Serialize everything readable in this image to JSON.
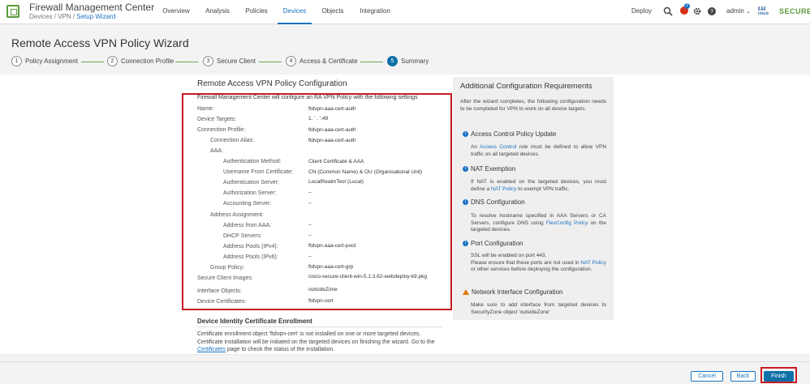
{
  "app": {
    "title": "Firewall Management Center",
    "breadcrumb_prefix": "Devices / VPN / ",
    "breadcrumb_link": "Setup Wizard"
  },
  "nav": [
    "Overview",
    "Analysis",
    "Policies",
    "Devices",
    "Objects",
    "Integration"
  ],
  "nav_active": "Devices",
  "topright": {
    "deploy": "Deploy",
    "alert_count": "2",
    "user": "admin",
    "brand_small": "cisco",
    "brand": "SECURE"
  },
  "wizard": {
    "title": "Remote Access VPN Policy Wizard",
    "steps": [
      {
        "num": "1",
        "label": "Policy Assignment"
      },
      {
        "num": "2",
        "label": "Connection Profile"
      },
      {
        "num": "3",
        "label": "Secure Client"
      },
      {
        "num": "4",
        "label": "Access & Certificate"
      },
      {
        "num": "5",
        "label": "Summary"
      }
    ]
  },
  "config": {
    "title": "Remote Access VPN Policy Configuration",
    "intro": "Firewall Management Center will configure an RA VPN Policy with the following settings",
    "rows": [
      {
        "label": "Name:",
        "value": "ftdvpn-aaa-cert-auth"
      },
      {
        "label": "Device Targets:",
        "value": "1. ' . '.49"
      },
      {
        "label": "Connection Profile:",
        "value": "ftdvpn-aaa-cert-auth"
      },
      {
        "label": "Connection Alias:",
        "value": "ftdvpn-aaa-cert-auth"
      },
      {
        "label": "AAA:",
        "value": ""
      },
      {
        "label": "Authentication Method:",
        "value": "Client Certificate & AAA"
      },
      {
        "label": "Username From Certificate:",
        "value": "CN (Common Name) & OU (Organisational Unit)"
      },
      {
        "label": "Authentication Server:",
        "value": "LocalRealmTest (Local)"
      },
      {
        "label": "Authorization Server:",
        "value": "–"
      },
      {
        "label": "Accounting Server:",
        "value": "–"
      },
      {
        "label": "Address Assignment:",
        "value": ""
      },
      {
        "label": "Address from AAA:",
        "value": "–"
      },
      {
        "label": "DHCP Servers:",
        "value": "–"
      },
      {
        "label": "Address Pools (IPv4):",
        "value": "ftdvpn-aaa-cert-pool"
      },
      {
        "label": "Address Pools (IPv6):",
        "value": "–"
      },
      {
        "label": "Group Policy:",
        "value": "ftdvpn-aaa-cert-grp"
      },
      {
        "label": "Secure Client Images:",
        "value": "cisco-secure-client-win-5.1.3.62-webdeploy-k9.pkg"
      },
      {
        "label": "Interface Objects:",
        "value": "outsideZone"
      },
      {
        "label": "Device Certificates:",
        "value": "ftdvpn-cert"
      }
    ],
    "enroll_title": "Device Identity Certificate Enrollment",
    "enroll_text_1": "Certificate enrollment object 'ftdvpn-cert' is not installed on one or more targeted devices. Certificate installation will be initiated on the targeted devices on finishing the wizard. Go to the ",
    "enroll_link": "Certificates",
    "enroll_text_2": " page to check the status of the installation."
  },
  "additional": {
    "title": "Additional Configuration Requirements",
    "intro": "After the wizard completes, the following configuration needs to be completed for VPN to work on all device targets.",
    "acp_title": "Access Control Policy Update",
    "acp_pre": "An ",
    "acp_link": "Access Control",
    "acp_post": " rule must be defined to allow VPN traffic on all targeted devices.",
    "nat_title": "NAT Exemption",
    "nat_pre": "If NAT is enabled on the targeted devices, you must define a ",
    "nat_link": "NAT Policy",
    "nat_post": " to exempt VPN traffic.",
    "dns_title": "DNS Configuration",
    "dns_pre": "To resolve hostname specified in AAA Servers or CA Servers, configure DNS using ",
    "dns_link": "FlexConfig Policy",
    "dns_post": " on the targeted devices.",
    "port_title": "Port Configuration",
    "port_line": "SSL will be enabled on port 443.",
    "port_pre": "Please ensure that these ports are not used in ",
    "port_link": "NAT Policy",
    "port_post": " or other services before deploying the configuration.",
    "nic_title": "Network Interface Configuration",
    "nic_text": "Make sure to add interface from targeted devices to SecurityZone object 'outsideZone'"
  },
  "footer": {
    "cancel": "Cancel",
    "back": "Back",
    "finish": "Finish"
  },
  "colors": {
    "accent": "#1a73c4",
    "primary_button": "#0e70a8",
    "highlight_border": "#c61b24",
    "brand_green": "#5a9a3a"
  }
}
